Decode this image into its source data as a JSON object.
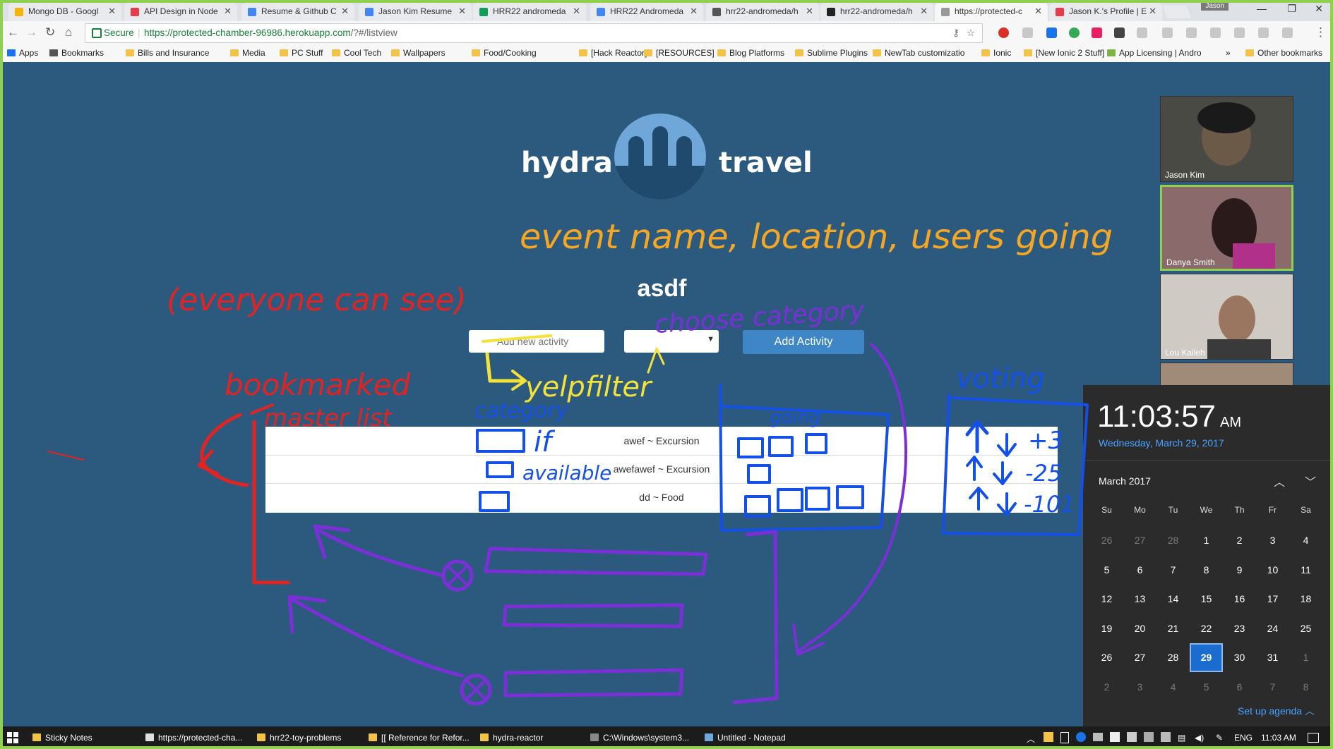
{
  "browser": {
    "tabs": [
      {
        "label": "Mongo DB - Googl",
        "color": "#f4b400"
      },
      {
        "label": "API Design in Node",
        "color": "#e83b4a"
      },
      {
        "label": "Resume & Github C",
        "color": "#4285f4"
      },
      {
        "label": "Jason Kim Resume",
        "color": "#4285f4"
      },
      {
        "label": "HRR22 andromeda",
        "color": "#0f9d58"
      },
      {
        "label": "HRR22 Andromeda",
        "color": "#4285f4"
      },
      {
        "label": "hrr22-andromeda/h",
        "color": "#555555"
      },
      {
        "label": "hrr22-andromeda/h",
        "color": "#222222"
      },
      {
        "label": "https://protected-c",
        "color": "#999999"
      },
      {
        "label": "Jason K.'s Profile | E",
        "color": "#e83b4a"
      }
    ],
    "user_chip": "Jason",
    "secure_label": "Secure",
    "url_host": "https://protected-chamber-96986.herokuapp.com",
    "url_path": "/?#/listview",
    "bookmarks": [
      "Apps",
      "Bookmarks",
      "Bills and Insurance",
      "Media",
      "PC Stuff",
      "Cool Tech",
      "Wallpapers",
      "Food/Cooking",
      "[Hack Reactor]",
      "[RESOURCES]",
      "Blog Platforms",
      "Sublime Plugins",
      "NewTab customizatio",
      "Ionic",
      "[New Ionic 2 Stuff]",
      "App Licensing | Andro",
      "»",
      "Other bookmarks"
    ]
  },
  "app": {
    "logo_left": "hydra",
    "logo_right": "travel",
    "title": "asdf",
    "activity_placeholder": "Add new activity",
    "add_button": "Add Activity",
    "activities": [
      "awef ~ Excursion",
      "awefawef ~ Excursion",
      "dd ~ Food"
    ]
  },
  "video_call": {
    "participants": [
      "Jason Kim",
      "Danya Smith",
      "Lou Kaileh"
    ]
  },
  "annotations": {
    "orange": "event name, location, users going",
    "red_top": "(everyone can see)",
    "red_mid": "bookmarked",
    "red_list": "master list",
    "yellow": "yelpfilter",
    "purple": "choose category",
    "blue_category": "category",
    "blue_if": "if",
    "blue_available": "available",
    "blue_going": "going",
    "blue_voting": "voting",
    "votes": [
      "+3",
      "-25",
      "-101"
    ]
  },
  "calendar": {
    "time": "11:03:57",
    "ampm": "AM",
    "date": "Wednesday, March 29, 2017",
    "month": "March 2017",
    "weekdays": [
      "Su",
      "Mo",
      "Tu",
      "We",
      "Th",
      "Fr",
      "Sa"
    ],
    "weeks": [
      [
        "26",
        "27",
        "28",
        "1",
        "2",
        "3",
        "4"
      ],
      [
        "5",
        "6",
        "7",
        "8",
        "9",
        "10",
        "11"
      ],
      [
        "12",
        "13",
        "14",
        "15",
        "16",
        "17",
        "18"
      ],
      [
        "19",
        "20",
        "21",
        "22",
        "23",
        "24",
        "25"
      ],
      [
        "26",
        "27",
        "28",
        "29",
        "30",
        "31",
        "1"
      ],
      [
        "2",
        "3",
        "4",
        "5",
        "6",
        "7",
        "8"
      ]
    ],
    "today": "29",
    "agenda": "Set up agenda"
  },
  "taskbar": {
    "items": [
      {
        "label": "Sticky Notes",
        "color": "#f3c24a"
      },
      {
        "label": "https://protected-cha...",
        "color": "#e0e0e0"
      },
      {
        "label": "hrr22-toy-problems",
        "color": "#f3c24a"
      },
      {
        "label": "[[ Reference for Refor...",
        "color": "#f3c24a"
      },
      {
        "label": "hydra-reactor",
        "color": "#f3c24a"
      },
      {
        "label": "C:\\Windows\\system3...",
        "color": "#888888"
      },
      {
        "label": "Untitled - Notepad",
        "color": "#6fa8dc"
      }
    ],
    "lang": "ENG",
    "clock": "11:03 AM"
  }
}
